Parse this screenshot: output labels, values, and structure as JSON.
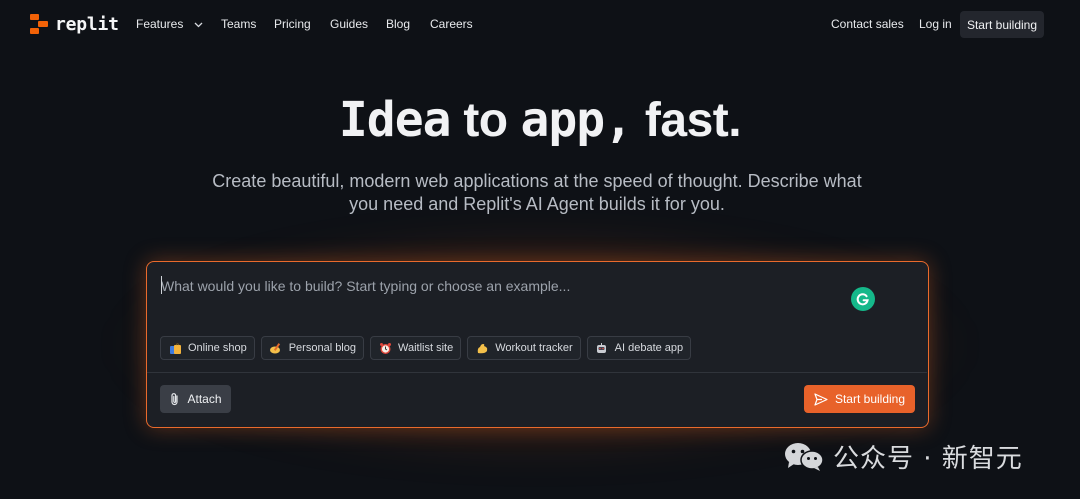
{
  "nav": {
    "logo_text": "replit",
    "links": [
      "Features",
      "Teams",
      "Pricing",
      "Guides",
      "Blog",
      "Careers"
    ],
    "contact_sales": "Contact sales",
    "log_in": "Log in",
    "start_building": "Start building"
  },
  "hero": {
    "title_pixel_1": "Idea",
    "title_plain_1": " to ",
    "title_pixel_2": "app,",
    "title_plain_2": " fast.",
    "subtitle": "Create beautiful, modern web applications at the speed of thought. Describe what you need and Replit's AI Agent builds it for you."
  },
  "prompt": {
    "placeholder": "What would you like to build? Start typing or choose an example...",
    "value": "",
    "chips": [
      {
        "label": "Online shop",
        "icon": "shopping-bags-icon"
      },
      {
        "label": "Personal blog",
        "icon": "writing-hand-icon"
      },
      {
        "label": "Waitlist site",
        "icon": "alarm-clock-icon"
      },
      {
        "label": "Workout tracker",
        "icon": "flexed-biceps-icon"
      },
      {
        "label": "AI debate app",
        "icon": "robot-face-icon"
      }
    ],
    "attach_label": "Attach",
    "submit_label": "Start building"
  },
  "watermark": {
    "text": "公众号 · 新智元"
  },
  "colors": {
    "accent": "#f26207",
    "cta": "#e8622a",
    "background": "#0e1116",
    "card": "#1c1f25",
    "grammarly": "#15b88a"
  }
}
